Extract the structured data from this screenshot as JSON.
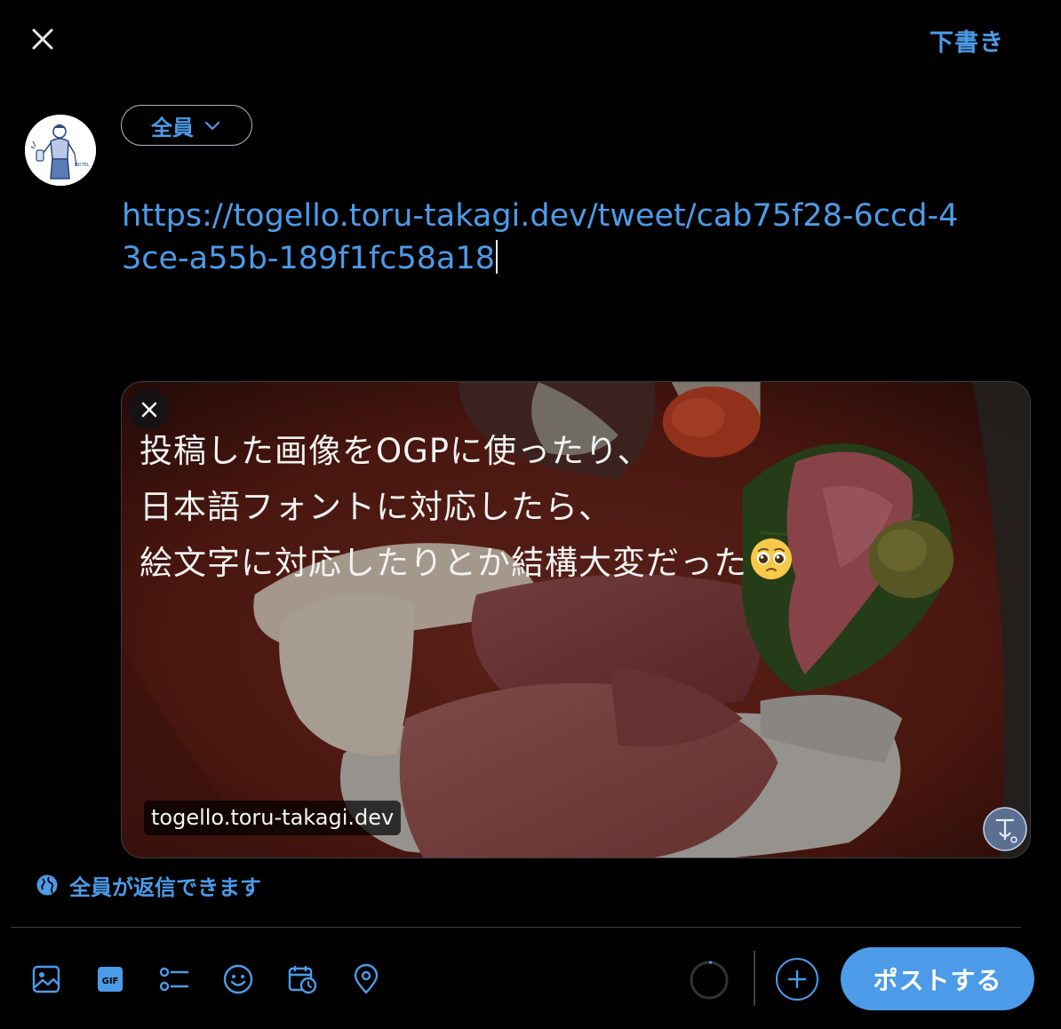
{
  "header": {
    "close_icon": "close-icon",
    "drafts_label": "下書き"
  },
  "composer": {
    "audience_label": "全員",
    "text": "https://togello.toru-takagi.dev/tweet/cab75f28-6ccd-43ce-a55b-189f1fc58a18"
  },
  "card": {
    "caption_lines": [
      "投稿した画像をOGPに使ったり、",
      "日本語フォントに対応したら、",
      "絵文字に対応したりとか結構大変だった"
    ],
    "emoji_icon": "pleading-face-icon",
    "domain": "togello.toru-takagi.dev"
  },
  "reply_setting": {
    "label": "全員が返信できます",
    "icon": "globe-icon"
  },
  "toolbar": {
    "icons": [
      "image-icon",
      "gif-icon",
      "poll-icon",
      "emoji-icon",
      "schedule-icon",
      "location-icon"
    ],
    "post_label": "ポストする"
  },
  "colors": {
    "accent": "#4c9be8",
    "background": "#000000",
    "border": "#3b3f44"
  }
}
